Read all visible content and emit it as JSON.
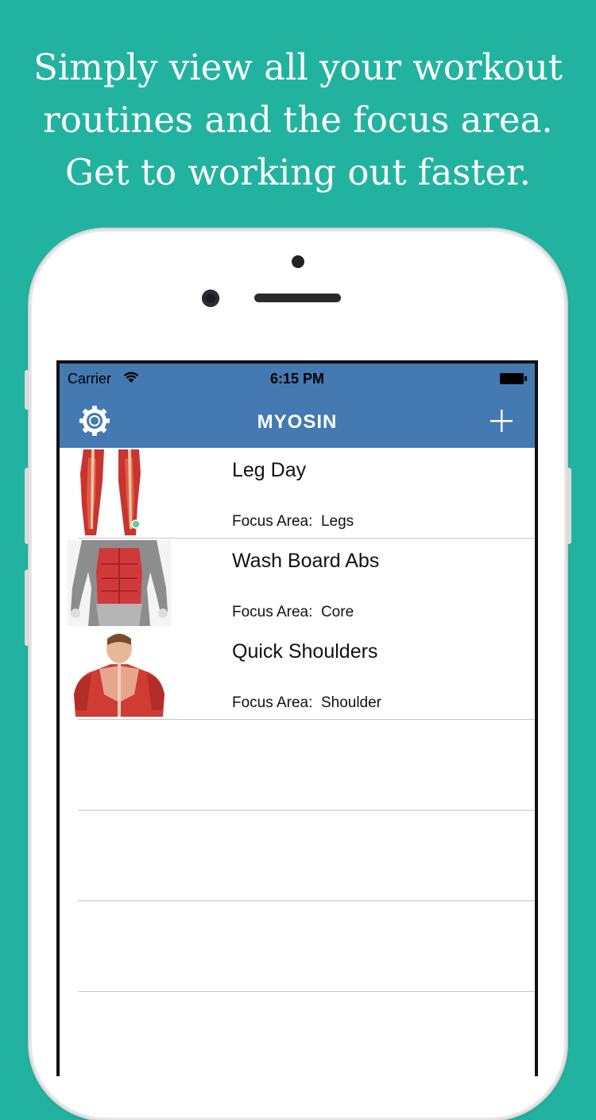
{
  "headline": {
    "line1": "Simply view all your workout",
    "line2": "routines and the focus area.",
    "line3": "Get to working out faster."
  },
  "status_bar": {
    "carrier": "Carrier",
    "time": "6:15 PM"
  },
  "nav": {
    "title": "MYOSIN",
    "left_icon": "gear-icon",
    "right_icon": "plus-icon"
  },
  "workouts": [
    {
      "title": "Leg Day",
      "focus_label": "Focus Area:",
      "focus": "Legs",
      "image": "legs-muscle-image"
    },
    {
      "title": "Wash Board Abs",
      "focus_label": "Focus Area:",
      "focus": "Core",
      "image": "abs-muscle-image"
    },
    {
      "title": "Quick Shoulders",
      "focus_label": "Focus Area:",
      "focus": "Shoulder",
      "image": "shoulders-muscle-image"
    }
  ],
  "colors": {
    "background": "#22b3a0",
    "nav_bar": "#4479b2",
    "muscle_red": "#c8342e"
  }
}
